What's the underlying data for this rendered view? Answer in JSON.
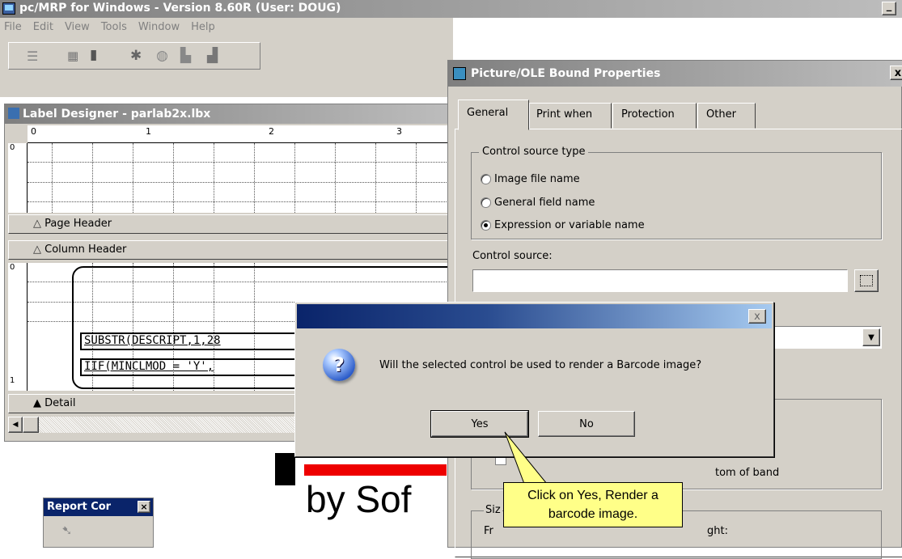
{
  "app": {
    "title": "pc/MRP for Windows - Version 8.60R  (User: DOUG)",
    "minimize": "_"
  },
  "menu": [
    "File",
    "Edit",
    "View",
    "Tools",
    "Window",
    "Help"
  ],
  "designer": {
    "title": "Label Designer - parlab2x.lbx",
    "ruler": [
      "0",
      "1",
      "2",
      "3"
    ],
    "vruler": [
      "0",
      "0",
      "1"
    ],
    "bands": {
      "page_header": "Page Header",
      "column_header": "Column Header",
      "detail": "Detail"
    },
    "fields": [
      "SUBSTR(DESCRIPT,1,28",
      "IIF(MINCLMOD = 'Y',"
    ]
  },
  "background": {
    "logo_line2": "by Sof",
    "report_controls": "Report Cor"
  },
  "props": {
    "title": "Picture/OLE Bound Properties",
    "close": "x",
    "tabs": [
      "General",
      "Print when",
      "Protection",
      "Other"
    ],
    "group_title": "Control source type",
    "radios": [
      "Image file name",
      "General field name",
      "Expression or variable name"
    ],
    "control_source_label": "Control source:",
    "control_source_value": "",
    "bottom_band": "tom of band",
    "size_label": "Siz",
    "from_label": "Fr",
    "height_label": "ght:"
  },
  "dialog": {
    "close": "x",
    "message": "Will the selected control be used to render a Barcode image?",
    "yes": "Yes",
    "no": "No",
    "icon": "?"
  },
  "callout": {
    "text": "Click on Yes, Render a barcode image."
  }
}
